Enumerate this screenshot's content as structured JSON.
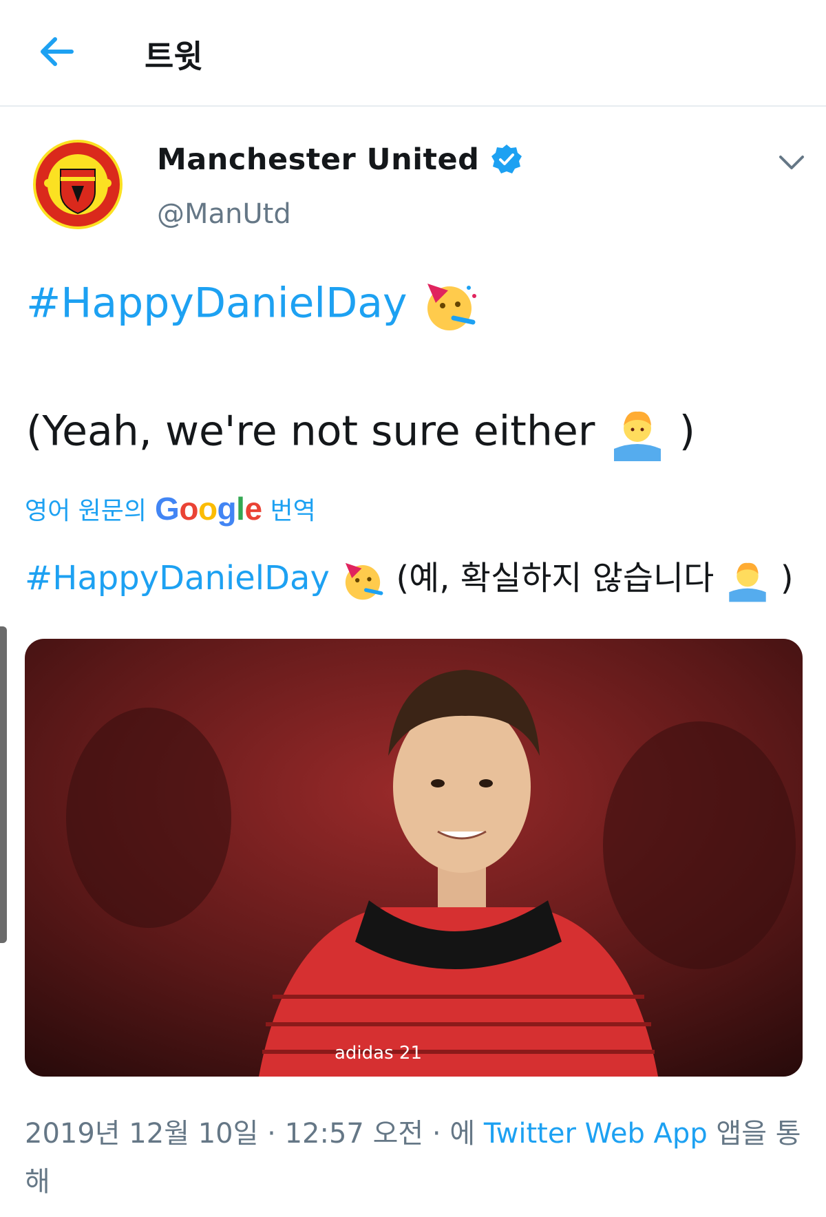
{
  "header": {
    "title": "트윗"
  },
  "tweet": {
    "author_name": "Manchester United",
    "handle": "@ManUtd",
    "line1_hashtag": "#HappyDanielDay",
    "line2_text": "(Yeah, we're not sure either",
    "line2_close": ")",
    "translate": {
      "prefix": "영어 원문의",
      "brand": "Google",
      "suffix": "번역"
    },
    "translated": {
      "hashtag": "#HappyDanielDay",
      "text": "(예, 확실하지 않습니다",
      "close": ")"
    },
    "media_alt": "adidas 21",
    "meta": {
      "date": "2019년 12월 10일",
      "sep1": " · ",
      "time": "12:57 오전",
      "sep2": " · 에 ",
      "source": "Twitter Web App",
      "suffix": " 앱을 통해"
    }
  },
  "icons": {
    "back": "arrow-left-icon",
    "verified": "verified-badge-icon",
    "more": "chevron-down-icon",
    "party": "partying-face-emoji",
    "shrug": "man-shrugging-emoji"
  },
  "colors": {
    "accent": "#1da1f2",
    "text": "#14171a",
    "secondary": "#657786",
    "club_red": "#da291c"
  }
}
